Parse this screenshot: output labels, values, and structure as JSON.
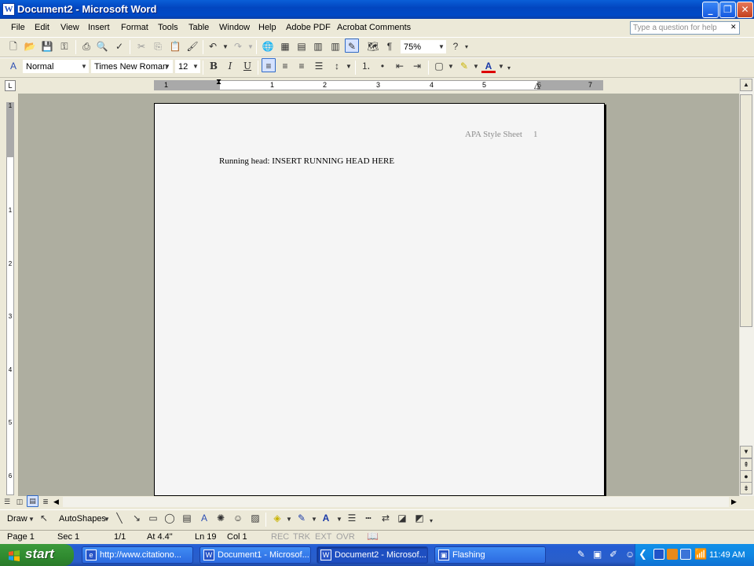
{
  "window": {
    "title": "Document2 - Microsoft Word",
    "app_icon": "W"
  },
  "menu": [
    "File",
    "Edit",
    "View",
    "Insert",
    "Format",
    "Tools",
    "Table",
    "Window",
    "Help",
    "Adobe PDF",
    "Acrobat Comments"
  ],
  "help_box": {
    "placeholder": "Type a question for help"
  },
  "standard_toolbar": {
    "zoom": "75%"
  },
  "formatting_toolbar": {
    "style": "Normal",
    "font": "Times New Roman",
    "size": "12",
    "bold": "B",
    "italic": "I",
    "underline": "U"
  },
  "ruler": {
    "h_numbers": [
      "1",
      "1",
      "2",
      "3",
      "4",
      "5",
      "6",
      "7"
    ],
    "v_numbers": [
      "1",
      "1",
      "2",
      "3",
      "4",
      "5",
      "6"
    ]
  },
  "document": {
    "header_text": "APA Style Sheet",
    "page_number": "1",
    "body_text": "Running head: INSERT RUNNING HEAD HERE"
  },
  "drawing_toolbar": {
    "draw": "Draw",
    "autoshapes": "AutoShapes"
  },
  "status_bar": {
    "page": "Page  1",
    "sec": "Sec  1",
    "pages": "1/1",
    "at": "At  4.4\"",
    "ln": "Ln  19",
    "col": "Col  1",
    "rec": "REC",
    "trk": "TRK",
    "ext": "EXT",
    "ovr": "OVR"
  },
  "taskbar": {
    "start": "start",
    "tasks": [
      "http://www.citationo...",
      "Document1 - Microsof...",
      "Document2 - Microsof...",
      "Flashing"
    ],
    "clock": "11:49 AM"
  },
  "colors": {
    "title_bar": "#0246c0",
    "page": "#f5f5f5",
    "workspace": "#aeaea0",
    "taskbar": "#245dd3",
    "start": "#2f8a2f"
  }
}
